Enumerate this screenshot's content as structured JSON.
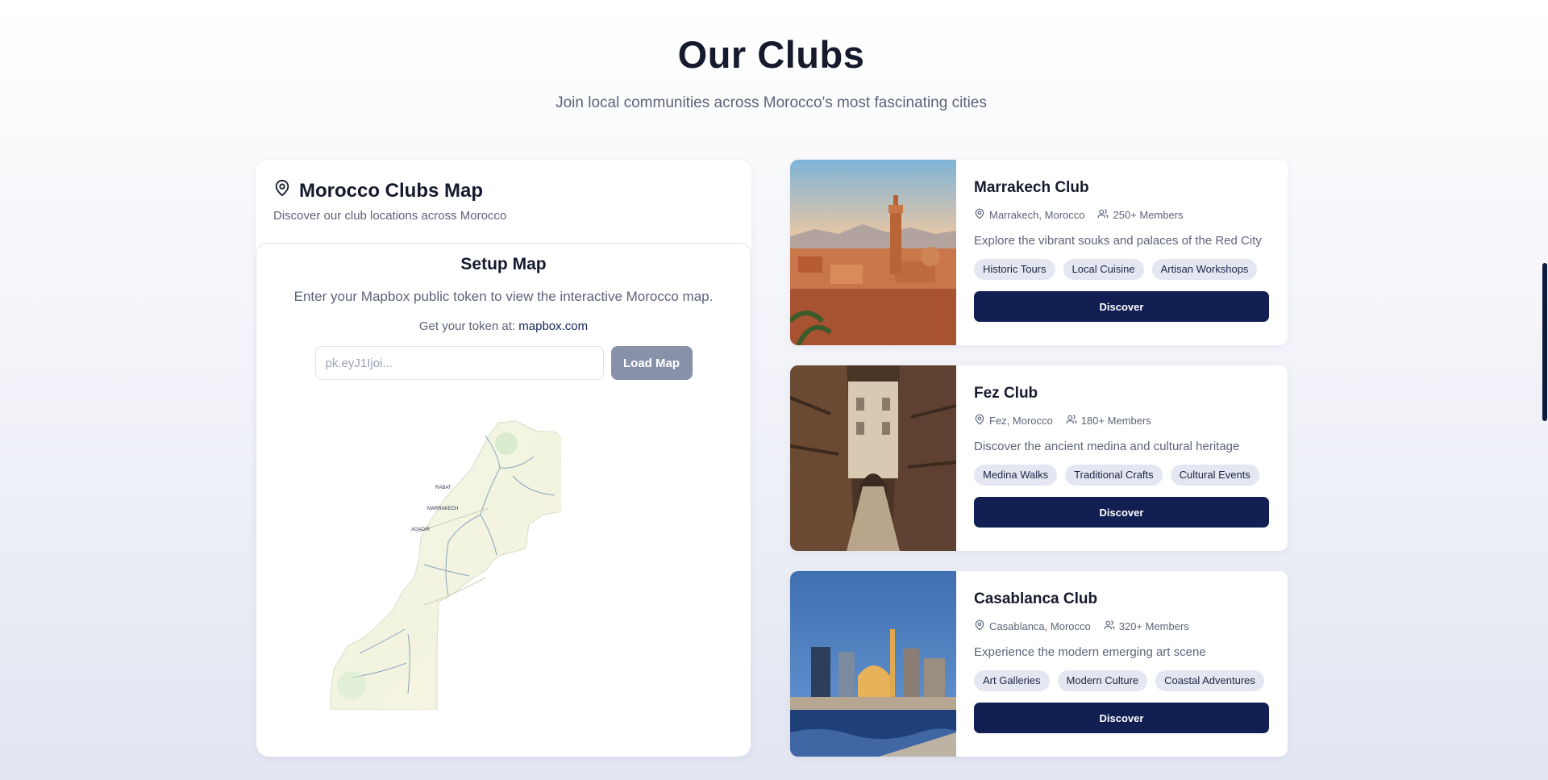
{
  "header": {
    "title": "Our Clubs",
    "subtitle": "Join local communities across Morocco's most fascinating cities"
  },
  "map_card": {
    "title": "Morocco Clubs Map",
    "description": "Discover our club locations across Morocco",
    "setup": {
      "title": "Setup Map",
      "description": "Enter your Mapbox public token to view the interactive Morocco map.",
      "token_prefix": "Get your token at:",
      "token_link": "mapbox.com",
      "input_placeholder": "pk.eyJ1Ijoi...",
      "input_value": "",
      "load_button": "Load Map"
    },
    "map_labels": [
      "RABAT",
      "MARRAKECH",
      "AGADIR"
    ]
  },
  "clubs": [
    {
      "name": "Marrakech Club",
      "location": "Marrakech, Morocco",
      "members": "250+ Members",
      "description": "Explore the vibrant souks and palaces of the Red City",
      "tags": [
        "Historic Tours",
        "Local Cuisine",
        "Artisan Workshops"
      ],
      "button": "Discover"
    },
    {
      "name": "Fez Club",
      "location": "Fez, Morocco",
      "members": "180+ Members",
      "description": "Discover the ancient medina and cultural heritage",
      "tags": [
        "Medina Walks",
        "Traditional Crafts",
        "Cultural Events"
      ],
      "button": "Discover"
    },
    {
      "name": "Casablanca Club",
      "location": "Casablanca, Morocco",
      "members": "320+ Members",
      "description": "Experience the modern emerging art scene",
      "tags": [
        "Art Galleries",
        "Modern Culture",
        "Coastal Adventures"
      ],
      "button": "Discover"
    }
  ],
  "colors": {
    "primary": "#121f52",
    "muted_button": "#8891aa",
    "tag_bg": "#e4e7f1",
    "text_muted": "#5b6478"
  },
  "icons": {
    "map_pin": "map-pin-icon",
    "users": "users-icon"
  }
}
